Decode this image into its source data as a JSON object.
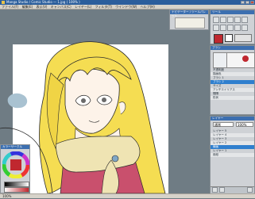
{
  "window": {
    "title": "Manga Studio / Comic Studio — 1.jpg  ( 100% )"
  },
  "menu": {
    "items": [
      "ファイル(F)",
      "編集(E)",
      "表示(V)",
      "キャンバス(C)",
      "レイヤー(L)",
      "フィルタ(T)",
      "ウインドウ(W)",
      "ヘルプ(H)"
    ]
  },
  "navigator": {
    "title": "ナビゲーター / ツールパレット"
  },
  "tool_palette": {
    "title": "ツール"
  },
  "brush_panel": {
    "title": "ブラシ",
    "rows": [
      "不透明度",
      "描画色",
      "ブラシ 1",
      "ブラシ 2",
      "サイズ",
      "アンチエイリアス",
      "間隔",
      "形状"
    ]
  },
  "layer_panel": {
    "title": "レイヤー",
    "mode": "通常",
    "opacity": "100%",
    "layers": [
      "レイヤー 5",
      "レイヤー 4",
      "レイヤー 3",
      "レイヤー 2",
      "線画",
      "レイヤー 1",
      "用紙"
    ]
  },
  "color_panel": {
    "title": "カラーサークル"
  },
  "status": {
    "text": "100%"
  },
  "colors": {
    "hair": "#f5dd52",
    "skin": "#fdf3e9",
    "dress": "#c9506d",
    "scarf": "#efe4b3",
    "accent_blue": "#2f7fce"
  }
}
